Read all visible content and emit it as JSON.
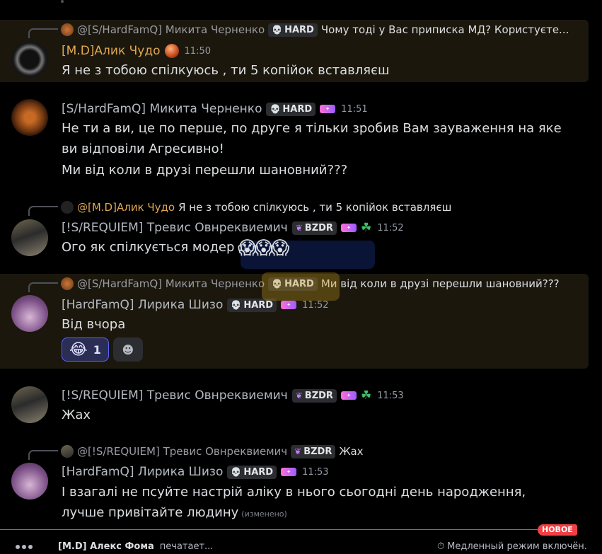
{
  "messages": [
    {
      "reply": {
        "name": "@[S/HardFamQ] Микита Черненко",
        "tag": "HARD",
        "text": "Чому тоді у Вас приписка МД? Користуєте..."
      },
      "author": "[M.D]Алик Чудо",
      "time": "11:50",
      "lines": [
        "Я не з тобою спілкуюсь , ти 5 копійок вставляєш"
      ]
    },
    {
      "author": "[S/HardFamQ] Микита Черненко",
      "tag": "HARD",
      "time": "11:51",
      "lines": [
        "Не ти а ви, це по перше, по друге я тільки зробив Вам зауваження на яке ви відповіли Агресивно!",
        "Ми від коли в друзі перешли шановний???"
      ]
    },
    {
      "reply": {
        "name": "@[M.D]Алик Чудо",
        "text": "Я не з тобою спілкуюсь , ти 5 копійок вставляєш"
      },
      "author": "[!S/REQUIEM] Тревис Овнреквиемич",
      "tag": "BZDR",
      "time": "11:52",
      "lines": [
        "Ого як спілкується модер дс"
      ]
    },
    {
      "reply": {
        "name": "@[S/HardFamQ] Микита Черненко",
        "tag": "HARD",
        "text": "Ми від коли в друзі перешли шановний???"
      },
      "author": "[HardFamQ] Лирика Шизо",
      "tag": "HARD",
      "time": "11:52",
      "lines": [
        "Від вчора"
      ],
      "reaction": {
        "emoji": "😂",
        "count": "1"
      }
    },
    {
      "author": "[!S/REQUIEM] Тревис Овнреквиемич",
      "tag": "BZDR",
      "time": "11:53",
      "lines": [
        "Жах"
      ]
    },
    {
      "reply": {
        "name": "@[!S/REQUIEM] Тревис Овнреквиемич",
        "tag": "BZDR",
        "text": "Жах"
      },
      "author": "[HardFamQ] Лирика Шизо",
      "tag": "HARD",
      "time": "11:53",
      "lines": [
        "І взагалі не псуйте настрій аліку в нього сьогодні день народження, лучше привітайте людину"
      ],
      "edited": "(изменено)"
    }
  ],
  "overlay_emoji": "😱😱😱",
  "new_badge": "НОВОЕ",
  "typing": {
    "name": "[M.D] Алекс Фома",
    "text": "печатает..."
  },
  "slowmode": "Медленный режим включён.",
  "icons": {
    "hard": "skull-icon",
    "bzdr": "butterfly-icon",
    "leaf": "clover-icon",
    "add_reaction": "add-reaction-icon",
    "slowmode": "stopwatch-icon"
  },
  "colors": {
    "highlight": "#1b170d",
    "gold_name": "#e2a74f",
    "accent": "#5865f2",
    "new_red": "#f23f43"
  }
}
